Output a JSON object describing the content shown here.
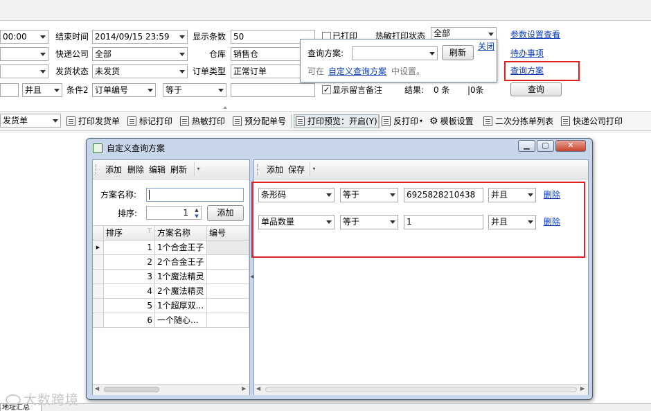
{
  "filter": {
    "start_time_value": "00:00",
    "end_time_label": "结束时间",
    "end_time_value": "2014/09/15 23:59",
    "display_count_label": "显示条数",
    "display_count_value": "50",
    "printed_label": "已打印",
    "thermal_status_label": "热敏打印状态",
    "thermal_status_value": "全部",
    "express_label": "快递公司",
    "express_value": "全部",
    "warehouse_label": "仓库",
    "warehouse_value": "销售仓",
    "ship_status_label": "发货状态",
    "ship_status_value": "未发货",
    "order_type_label": "订单类型",
    "order_type_value": "正常订单",
    "logic_value": "并且",
    "cond2_label": "条件2",
    "cond2_field_value": "订单编号",
    "cond2_op_value": "等于",
    "show_msg_label": "显示留言备注",
    "result_label": "结果:",
    "result_count": "0 条",
    "result_count2": "|0条",
    "query_button": "查询",
    "links": {
      "params": "参数设置查看",
      "todo": "待办事项",
      "scheme": "查询方案"
    }
  },
  "popup": {
    "scheme_label": "查询方案:",
    "refresh": "刷新",
    "close": "关闭",
    "hint_prefix": "可在",
    "hint_link": "自定义查询方案",
    "hint_suffix": "中设置。"
  },
  "toolbar": {
    "doc_type": "发货单",
    "items": [
      "打印发货单",
      "标记打印",
      "热敏打印",
      "预分配单号",
      "打印预览：开启(Y)",
      "反打印",
      "模板设置",
      "二次分拣单列表",
      "快递公司打印"
    ]
  },
  "dialog": {
    "title": "自定义查询方案",
    "left_toolbar": [
      "添加",
      "删除",
      "编辑",
      "刷新"
    ],
    "right_toolbar": [
      "添加",
      "保存"
    ],
    "name_label": "方案名称:",
    "name_value": "",
    "sort_label": "排序:",
    "sort_value": "1",
    "add_button": "添加",
    "grid_headers": [
      "排序",
      "方案名称",
      "编号"
    ],
    "grid_rows": [
      {
        "sort": "1",
        "name": "1个合金王子",
        "code": ""
      },
      {
        "sort": "2",
        "name": "2个合金王子",
        "code": ""
      },
      {
        "sort": "3",
        "name": "1个魔法精灵",
        "code": ""
      },
      {
        "sort": "4",
        "name": "2个魔法精灵",
        "code": ""
      },
      {
        "sort": "5",
        "name": "1个超厚双...",
        "code": ""
      },
      {
        "sort": "6",
        "name": "一个随心...",
        "code": ""
      }
    ],
    "conditions": [
      {
        "field": "条形码",
        "op": "等于",
        "value": "6925828210438",
        "logic": "并且",
        "delete": "删除"
      },
      {
        "field": "单品数量",
        "op": "等于",
        "value": "1",
        "logic": "并且",
        "delete": "删除"
      }
    ]
  },
  "watermark": "大数跨境",
  "bottom_tab": "地址汇总",
  "colors": {
    "highlight_red": "#e02020",
    "link_blue": "#0a3bb5",
    "dialog_frame": "#c7d6ea"
  }
}
